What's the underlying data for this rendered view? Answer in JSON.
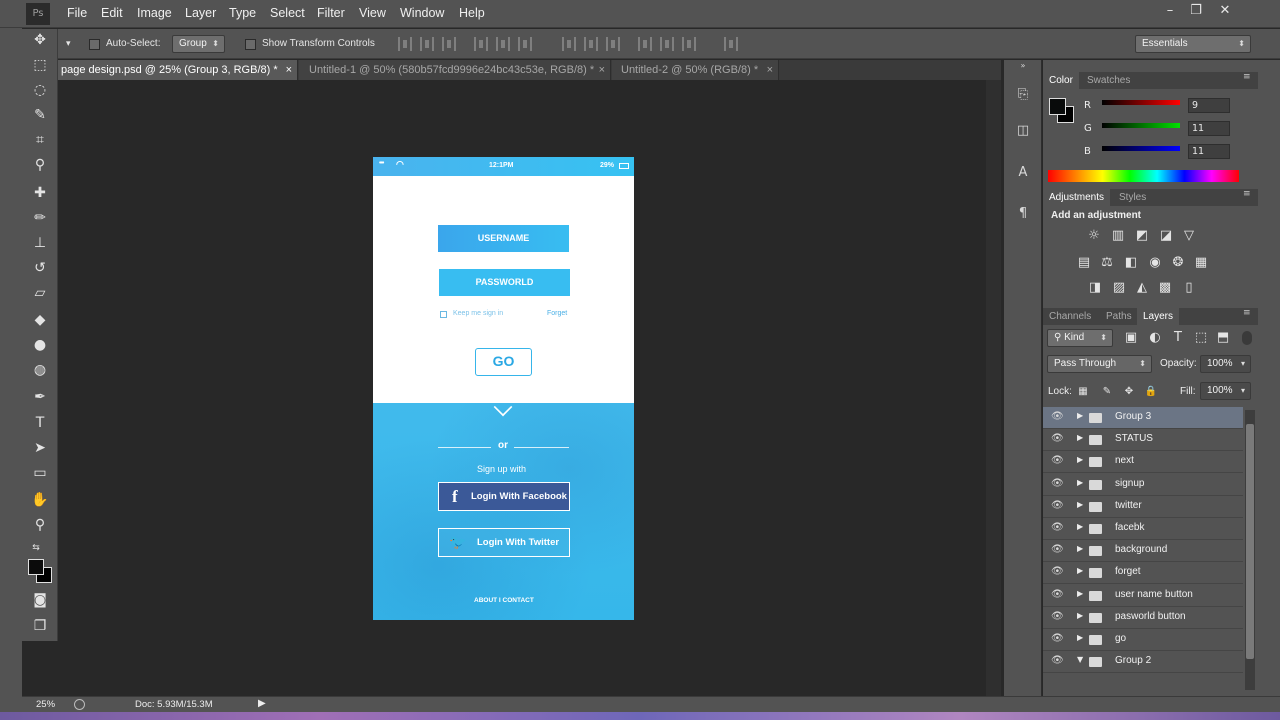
{
  "app": {
    "logo": "Ps",
    "menu": [
      "File",
      "Edit",
      "Image",
      "Layer",
      "Type",
      "Select",
      "Filter",
      "View",
      "Window",
      "Help"
    ],
    "window_buttons": [
      "–",
      "❐",
      "✕"
    ]
  },
  "options_bar": {
    "auto_select_label": "Auto-Select:",
    "auto_select_value": "Group",
    "transform_label": "Show Transform Controls",
    "workspace": "Essentials"
  },
  "tabs": [
    {
      "label": "page design.psd @ 25% (Group 3, RGB/8) *",
      "close": "×",
      "active": true
    },
    {
      "label": "Untitled-1 @ 50% (580b57fcd9996e24bc43c53e, RGB/8) *",
      "close": "×",
      "active": false
    },
    {
      "label": "Untitled-2 @ 50% (RGB/8) *",
      "close": "×",
      "active": false
    }
  ],
  "artboard": {
    "status": {
      "signal": "•••",
      "wifi": "◠",
      "time": "12:1PM",
      "battery": "29%"
    },
    "username_label": "USERNAME",
    "password_label": "PASSWORLD",
    "keep_sign_in": "Keep me sign in",
    "forget": "Forget",
    "go": "GO",
    "chevron": "⌄",
    "or": "or",
    "sign_up_with": "Sign up with",
    "facebook_icon": "f",
    "facebook_label": "Login With Facebook",
    "twitter_icon": "🐦",
    "twitter_label": "Login With Twitter",
    "footer": "ABOUT I CONTACT"
  },
  "color_panel": {
    "tabs": [
      "Color",
      "Swatches"
    ],
    "r_label": "R",
    "g_label": "G",
    "b_label": "B",
    "r": "9",
    "g": "11",
    "b": "11"
  },
  "adjustments_panel": {
    "tabs": [
      "Adjustments",
      "Styles"
    ],
    "heading": "Add an adjustment"
  },
  "layers_panel": {
    "tabs": [
      "Channels",
      "Paths",
      "Layers"
    ],
    "kind_filter": "Kind",
    "blend_mode": "Pass Through",
    "opacity_label": "Opacity:",
    "opacity": "100%",
    "lock_label": "Lock:",
    "fill_label": "Fill:",
    "fill": "100%",
    "layers": [
      {
        "name": "Group 3",
        "expanded": false,
        "selected": true
      },
      {
        "name": "STATUS",
        "expanded": false,
        "selected": false
      },
      {
        "name": "next",
        "expanded": false,
        "selected": false
      },
      {
        "name": "signup",
        "expanded": false,
        "selected": false
      },
      {
        "name": "twitter",
        "expanded": false,
        "selected": false
      },
      {
        "name": "facebk",
        "expanded": false,
        "selected": false
      },
      {
        "name": "background",
        "expanded": false,
        "selected": false
      },
      {
        "name": "forget",
        "expanded": false,
        "selected": false
      },
      {
        "name": "user name button",
        "expanded": false,
        "selected": false
      },
      {
        "name": "pasworld button",
        "expanded": false,
        "selected": false
      },
      {
        "name": "go",
        "expanded": false,
        "selected": false
      },
      {
        "name": "Group 2",
        "expanded": true,
        "selected": false
      }
    ]
  },
  "status_bar": {
    "zoom": "25%",
    "doc": "Doc: 5.93M/15.3M"
  },
  "colors": {
    "accent": "#2aa8e4",
    "field_blue": "#34b6ef",
    "panel": "#535353",
    "canvas": "#282828",
    "selected_layer": "#6b7585"
  }
}
